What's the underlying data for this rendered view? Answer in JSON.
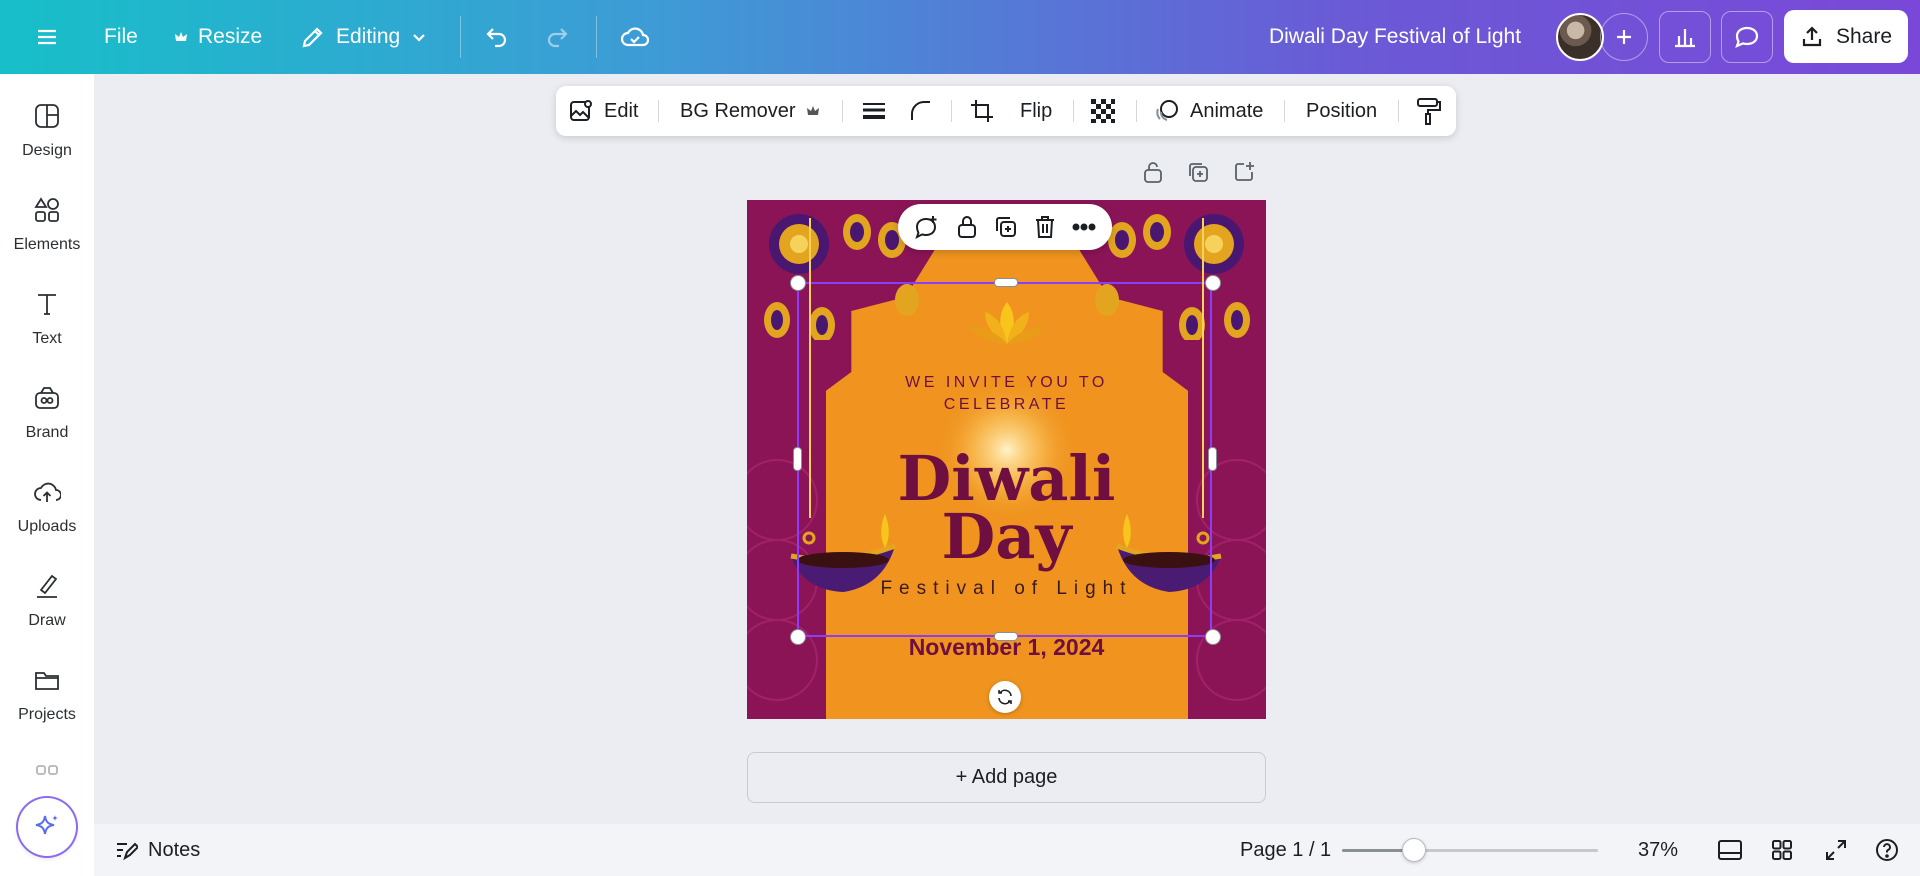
{
  "topbar": {
    "file_label": "File",
    "resize_label": "Resize",
    "editing_label": "Editing",
    "doc_title": "Diwali Day Festival of Light",
    "share_label": "Share"
  },
  "sidebar": {
    "items": [
      {
        "label": "Design",
        "icon": "design-icon"
      },
      {
        "label": "Elements",
        "icon": "elements-icon"
      },
      {
        "label": "Text",
        "icon": "text-icon"
      },
      {
        "label": "Brand",
        "icon": "brand-icon"
      },
      {
        "label": "Uploads",
        "icon": "uploads-icon"
      },
      {
        "label": "Draw",
        "icon": "draw-icon"
      },
      {
        "label": "Projects",
        "icon": "projects-icon"
      }
    ]
  },
  "context_toolbar": {
    "edit_label": "Edit",
    "bg_remover_label": "BG Remover",
    "flip_label": "Flip",
    "animate_label": "Animate",
    "position_label": "Position"
  },
  "canvas": {
    "invite_line1": "WE INVITE YOU TO",
    "invite_line2": "CELEBRATE",
    "title_line1": "Diwali",
    "title_line2": "Day",
    "subtitle": "Festival of Light",
    "date": "November 1, 2024"
  },
  "add_page_label": "+ Add page",
  "bottombar": {
    "notes_label": "Notes",
    "page_indicator": "Page 1 / 1",
    "zoom_value": "37%",
    "zoom_fraction": 0.28
  },
  "colors": {
    "accent": "#8b3dff",
    "canvas_bg": "#8b1457",
    "arch": "#f0941f",
    "text_maroon": "#6e0f3f"
  }
}
